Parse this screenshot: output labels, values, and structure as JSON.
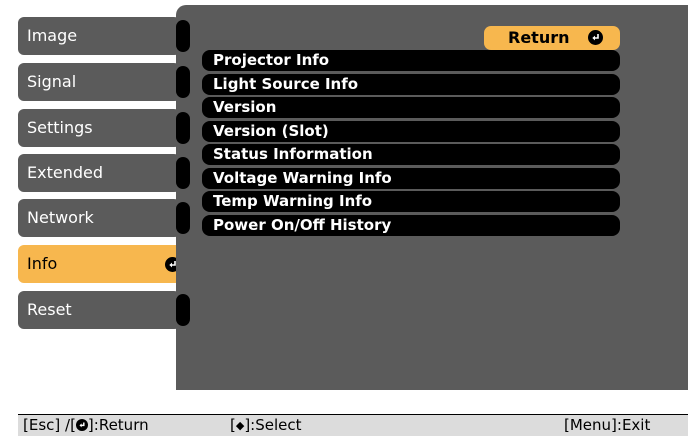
{
  "sidebar": {
    "items": [
      {
        "label": "Image",
        "selected": false
      },
      {
        "label": "Signal",
        "selected": false
      },
      {
        "label": "Settings",
        "selected": false
      },
      {
        "label": "Extended",
        "selected": false
      },
      {
        "label": "Network",
        "selected": false
      },
      {
        "label": "Info",
        "selected": true
      },
      {
        "label": "Reset",
        "selected": false
      }
    ]
  },
  "main": {
    "return_label": "Return",
    "items": [
      "Projector Info",
      "Light Source Info",
      "Version",
      "Version (Slot)",
      "Status Information",
      "Voltage Warning Info",
      "Temp Warning Info",
      "Power On/Off History"
    ]
  },
  "footer": {
    "esc_prefix": "[Esc] /[",
    "esc_suffix": "]:Return",
    "select_prefix": "[",
    "select_glyph": "◆",
    "select_suffix": "]:Select",
    "exit_label": "[Menu]:Exit"
  },
  "colors": {
    "panel": "#5b5b5b",
    "accent": "#f7b74e",
    "item_bg": "#000000",
    "footer_bg": "#dcdcdc"
  },
  "icons": {
    "enter": "enter-icon",
    "up_down": "up-down-icon"
  }
}
